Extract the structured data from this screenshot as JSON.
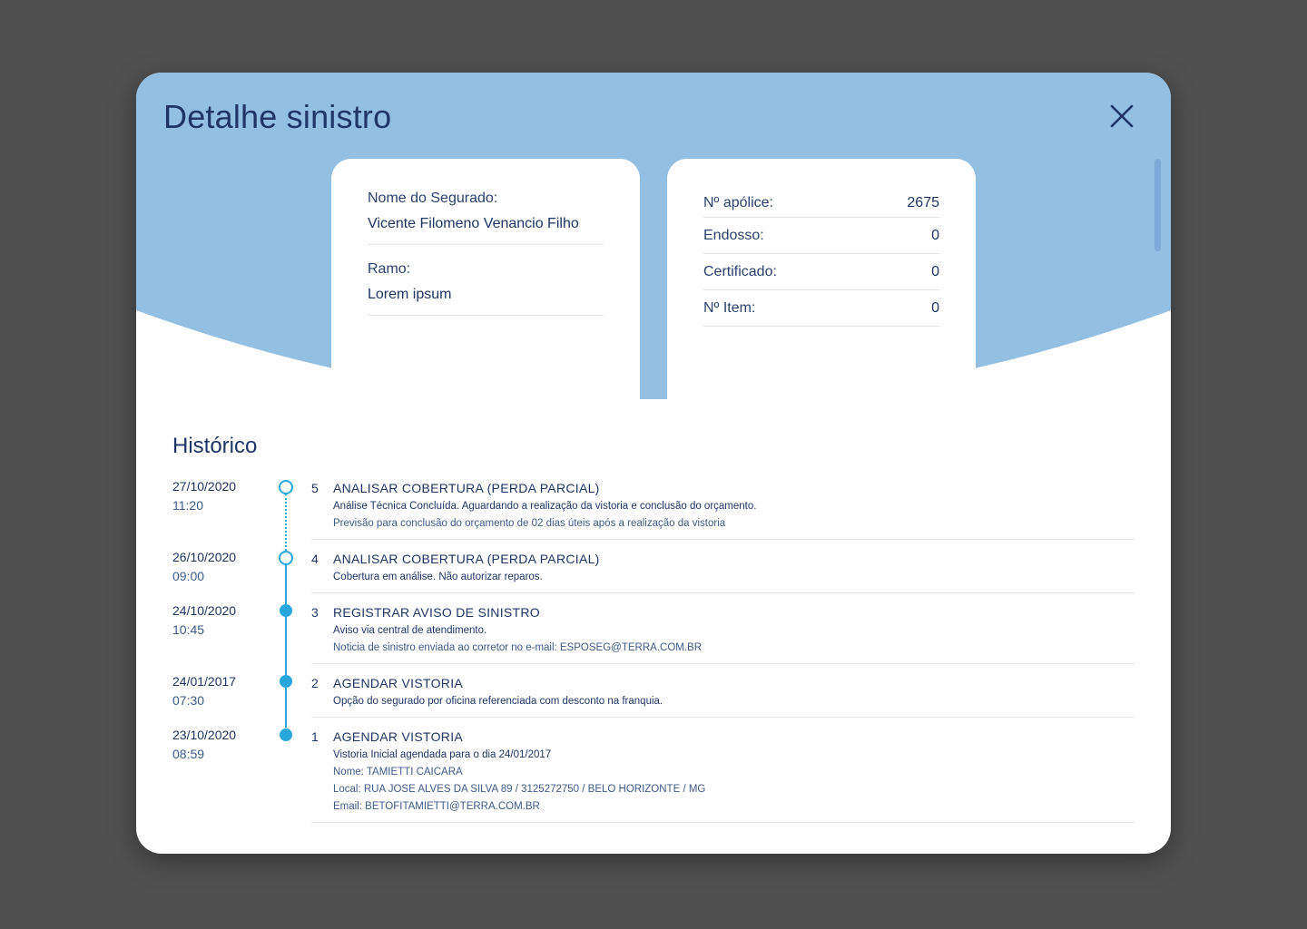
{
  "modal": {
    "title": "Detalhe sinistro",
    "close_icon": "close-icon",
    "header_color": "#93bfe3",
    "accent_color": "#27a7dc"
  },
  "insured_card": {
    "name_label": "Nome do Segurado:",
    "name_value": "Vicente Filomeno Venancio Filho",
    "ramo_label": "Ramo:",
    "ramo_value": "Lorem ipsum"
  },
  "policy_card": {
    "rows": [
      {
        "label": "Nº apólice:",
        "value": "2675"
      },
      {
        "label": "Endosso:",
        "value": "0"
      },
      {
        "label": "Certificado:",
        "value": "0"
      },
      {
        "label": "Nº Item:",
        "value": "0"
      }
    ]
  },
  "history": {
    "title": "Histórico",
    "entries": [
      {
        "date": "27/10/2020",
        "time": "11:20",
        "number": "5",
        "status": "pending",
        "title": "ANALISAR COBERTURA (PERDA PARCIAL)",
        "description": "Análise Técnica Concluída. Aguardando a realização da vistoria e conclusão do orçamento.",
        "details": [
          "Previsão para conclusão do orçamento de 02 dias úteis após a realização da vistoria"
        ]
      },
      {
        "date": "26/10/2020",
        "time": "09:00",
        "number": "4",
        "status": "pending",
        "title": "ANALISAR COBERTURA (PERDA PARCIAL)",
        "description": "Cobertura em análise. Não autorizar reparos.",
        "details": []
      },
      {
        "date": "24/10/2020",
        "time": "10:45",
        "number": "3",
        "status": "done",
        "title": "REGISTRAR AVISO DE SINISTRO",
        "description": "Aviso via central de atendimento.",
        "details": [
          "Noticia de sinistro enviada ao corretor no e-mail: ESPOSEG@TERRA.COM.BR"
        ]
      },
      {
        "date": "24/01/2017",
        "time": "07:30",
        "number": "2",
        "status": "done",
        "title": "AGENDAR VISTORIA",
        "description": "Opção do segurado por oficina referenciada com desconto na franquia.",
        "details": []
      },
      {
        "date": "23/10/2020",
        "time": "08:59",
        "number": "1",
        "status": "done",
        "title": "AGENDAR VISTORIA",
        "description": "Vistoria Inicial agendada para o dia 24/01/2017",
        "details": [
          "Nome: TAMIETTI CAICARA",
          "Local: RUA JOSE ALVES DA SILVA 89 / 3125272750 / BELO HORIZONTE / MG",
          "Email: BETOFITAMIETTI@TERRA.COM.BR"
        ]
      }
    ]
  }
}
